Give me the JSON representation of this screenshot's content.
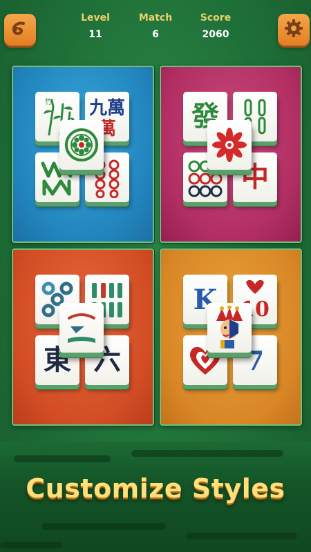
{
  "header": {
    "back_button": {
      "icon": "back-arrow-icon"
    },
    "settings_button": {
      "icon": "gear-icon"
    },
    "stats": [
      {
        "label": "Level",
        "value": "11"
      },
      {
        "label": "Match",
        "value": "6"
      },
      {
        "label": "Score",
        "value": "2060"
      }
    ]
  },
  "styles": [
    {
      "theme_color": "#2284bd",
      "tiles": {
        "top_left": "bamboo-icon",
        "top_right": "九萬",
        "bottom_left": "bamboo-sticks-icon",
        "bottom_right": "eight-dots-icon",
        "center": "flower-circle-icon"
      }
    },
    {
      "theme_color": "#b02e62",
      "tiles": {
        "top_left": "發",
        "top_right": "two-bamboo-icon",
        "bottom_left": "six-circles-icon",
        "bottom_right": "中",
        "center": "red-flower-icon"
      }
    },
    {
      "theme_color": "#d24d24",
      "tiles": {
        "top_left": "circles-icon",
        "top_right": "bamboo-bars-icon",
        "bottom_left": "東",
        "bottom_right": "六",
        "center": "wave-icon"
      }
    },
    {
      "theme_color": "#d98726",
      "tiles": {
        "top_left": "K",
        "top_right": "10",
        "bottom_left": "heart-icon",
        "bottom_right": "7",
        "center": "jester-icon"
      }
    }
  ],
  "footer": {
    "title": "Customize Styles"
  }
}
